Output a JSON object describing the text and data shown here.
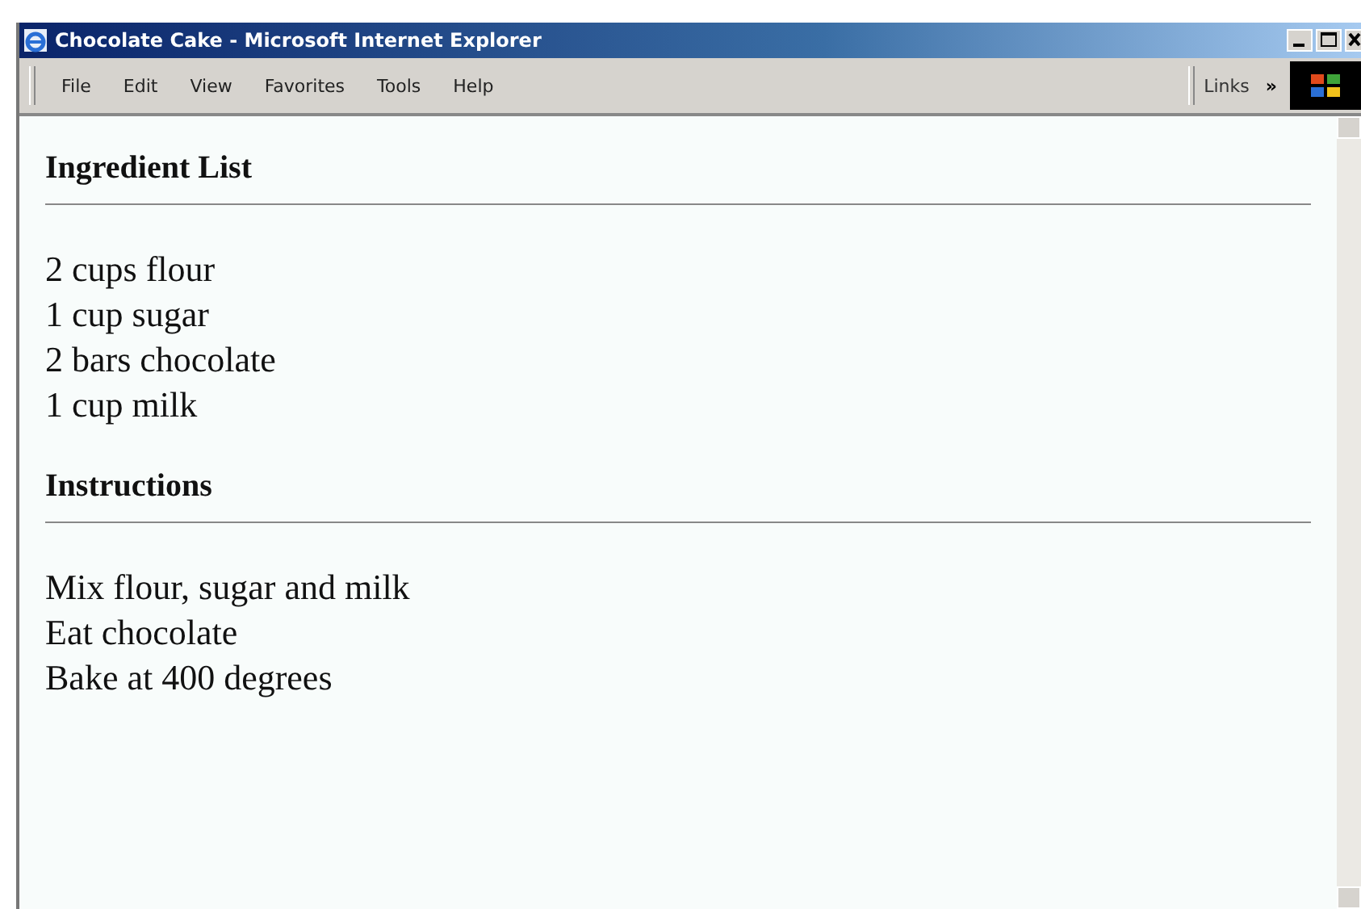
{
  "window": {
    "title": "Chocolate Cake - Microsoft Internet Explorer"
  },
  "menu": [
    "File",
    "Edit",
    "View",
    "Favorites",
    "Tools",
    "Help"
  ],
  "links": {
    "label": "Links",
    "chevron": "»"
  },
  "sections": [
    {
      "heading": "Ingredient List",
      "lines": [
        "2 cups flour",
        "1 cup sugar",
        "2 bars chocolate",
        "1 cup milk"
      ]
    },
    {
      "heading": "Instructions",
      "lines": [
        "Mix flour, sugar and milk",
        "Eat chocolate",
        "Bake at 400 degrees"
      ]
    }
  ]
}
